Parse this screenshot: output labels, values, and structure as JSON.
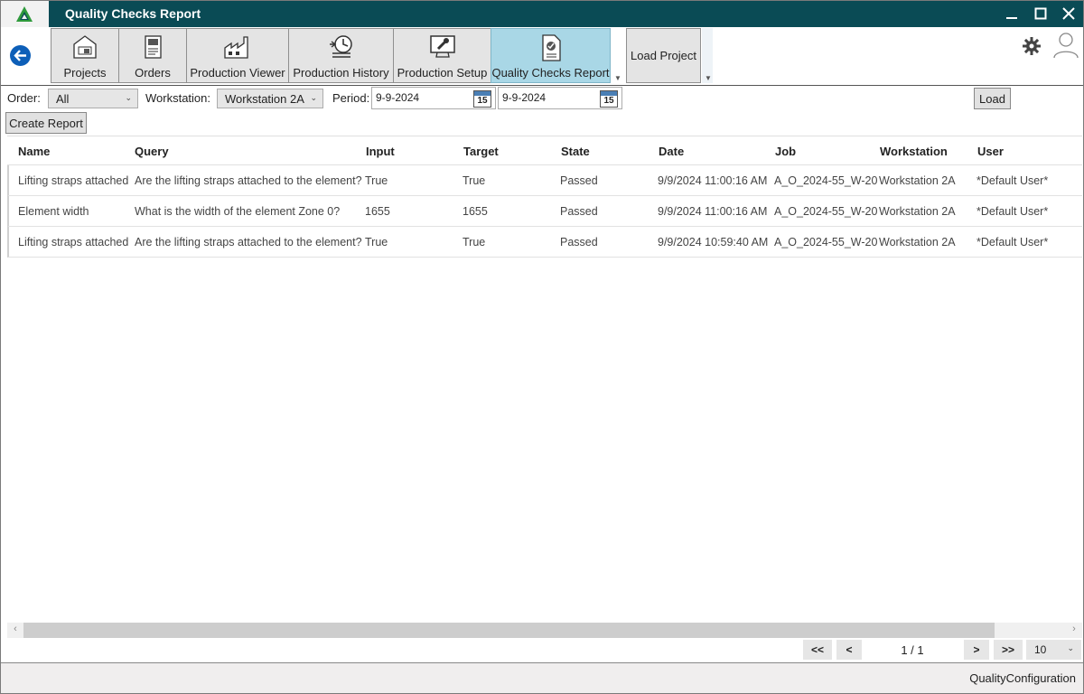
{
  "window": {
    "title": "Quality Checks Report",
    "minimize_label": "—",
    "maximize_label": "☐",
    "close_label": "✕"
  },
  "ribbon": {
    "tabs": [
      {
        "label": "Projects",
        "icon": "projects-icon"
      },
      {
        "label": "Orders",
        "icon": "orders-icon"
      },
      {
        "label": "Production Viewer",
        "icon": "factory-icon"
      },
      {
        "label": "Production History",
        "icon": "history-icon"
      },
      {
        "label": "Production Setup",
        "icon": "setup-icon"
      },
      {
        "label": "Quality Checks Report",
        "icon": "report-icon",
        "active": true
      }
    ],
    "load_project_label": "Load Project"
  },
  "filters": {
    "order_label": "Order:",
    "order_value": "All",
    "workstation_label": "Workstation:",
    "workstation_value": "Workstation 2A",
    "period_label": "Period:",
    "period_from": "9-9-2024",
    "period_to": "9-9-2024",
    "calendar_day": "15",
    "load_label": "Load",
    "create_report_label": "Create Report"
  },
  "grid": {
    "columns": [
      "Name",
      "Query",
      "Input",
      "Target",
      "State",
      "Date",
      "Job",
      "Workstation",
      "User"
    ],
    "rows": [
      [
        "Lifting straps attached",
        "Are the lifting straps attached to the element?",
        "True",
        "True",
        "Passed",
        "9/9/2024 11:00:16 AM",
        "A_O_2024-55_W-20",
        "Workstation 2A",
        "*Default User*"
      ],
      [
        "Element width",
        "What is the width of the element Zone 0?",
        "1655",
        "1655",
        "Passed",
        "9/9/2024 11:00:16 AM",
        "A_O_2024-55_W-20",
        "Workstation 2A",
        "*Default User*"
      ],
      [
        "Lifting straps attached",
        "Are the lifting straps attached to the element?",
        "True",
        "True",
        "Passed",
        "9/9/2024 10:59:40 AM",
        "A_O_2024-55_W-20",
        "Workstation 2A",
        "*Default User*"
      ]
    ]
  },
  "pager": {
    "first": "<<",
    "prev": "<",
    "page_text": "1 / 1",
    "next": ">",
    "last": ">>",
    "page_size": "10"
  },
  "status": {
    "text": "QualityConfiguration"
  },
  "colors": {
    "titlebar": "#0a4b55",
    "active_tab": "#a9d7e6",
    "back_button": "#0d5fb8"
  }
}
